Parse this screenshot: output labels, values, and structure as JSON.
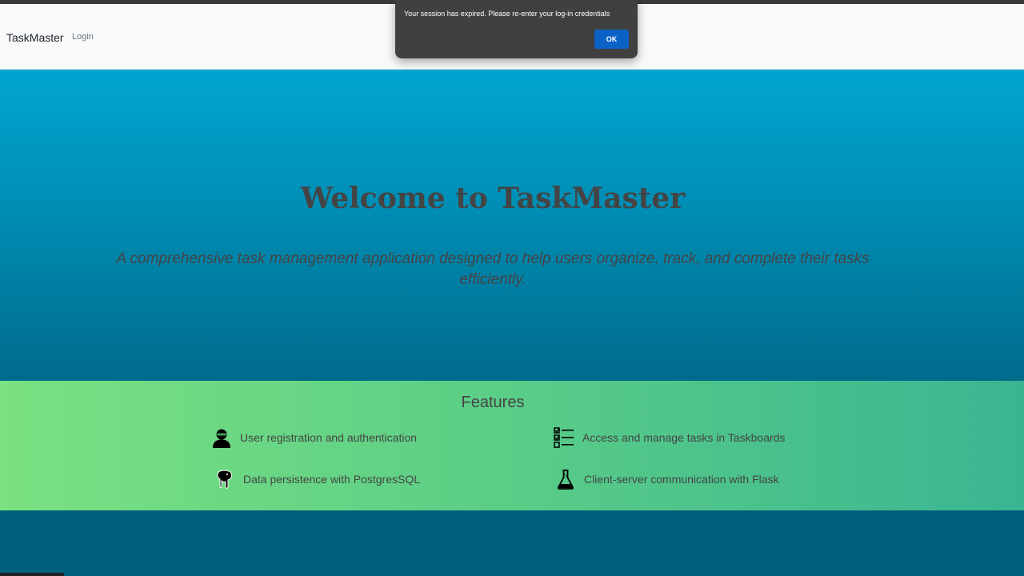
{
  "navbar": {
    "brand": "TaskMaster",
    "login_label": "Login"
  },
  "hero": {
    "title": "Welcome to TaskMaster",
    "subtitle": "A comprehensive task management application designed to help users organize, track, and complete their tasks efficiently."
  },
  "features": {
    "title": "Features",
    "items": [
      {
        "label": "User registration and authentication",
        "icon": "user-icon"
      },
      {
        "label": "Access and manage tasks in Taskboards",
        "icon": "checklist-icon"
      },
      {
        "label": "Data persistence with PostgresSQL",
        "icon": "postgres-elephant-icon"
      },
      {
        "label": "Client-server communication with Flask",
        "icon": "flask-icon"
      }
    ]
  },
  "dialog": {
    "message": "Your session has expired. Please re-enter your log-in credentials",
    "ok_label": "OK"
  },
  "colors": {
    "navbar_bg": "#f8f9fa",
    "hero_top": "#00a6d0",
    "hero_bottom": "#006b8c",
    "features_left": "#7be182",
    "features_right": "#3ab592",
    "footer_bg": "#005f7b",
    "dialog_bg": "#404040",
    "ok_button": "#0a62c7"
  }
}
